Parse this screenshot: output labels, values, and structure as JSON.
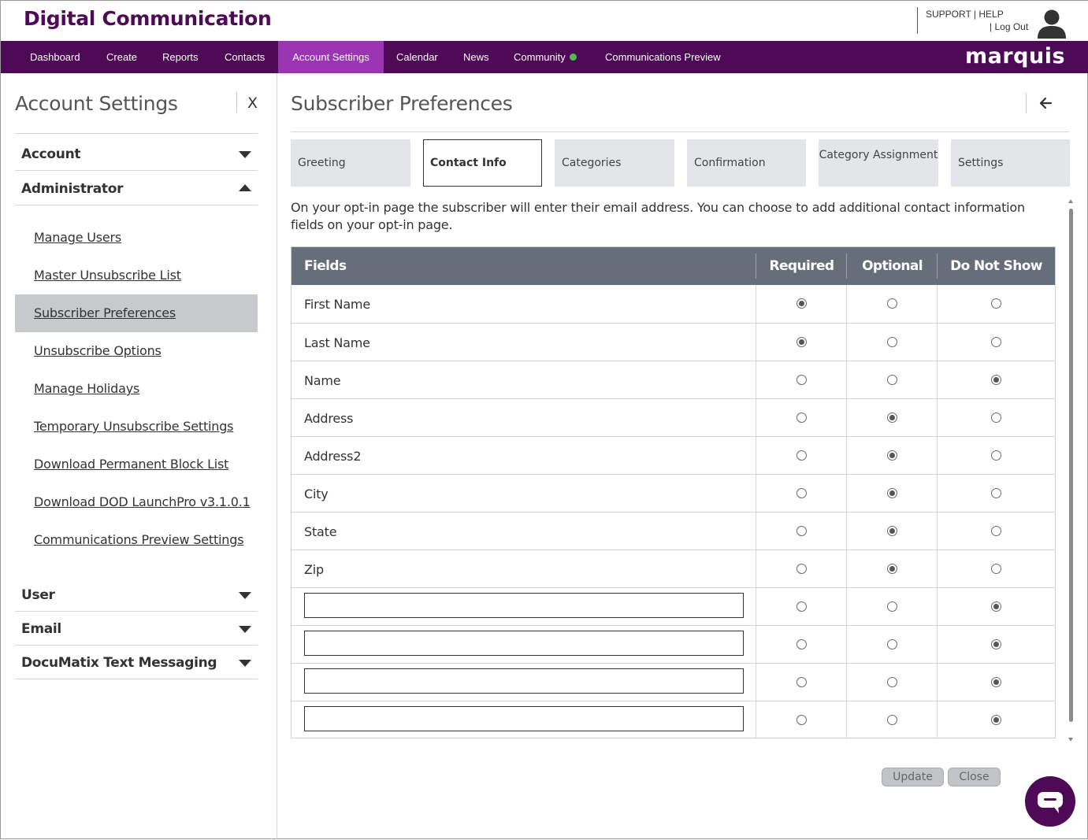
{
  "header": {
    "brand": "Digital Communication",
    "support": "SUPPORT",
    "sep1": "|",
    "help": "HELP",
    "sep2": "|",
    "logout": "Log Out",
    "logo": "marquis"
  },
  "nav": {
    "items": [
      "Dashboard",
      "Create",
      "Reports",
      "Contacts",
      "Account Settings",
      "Calendar",
      "News",
      "Community",
      "Communications Preview"
    ],
    "active": "Account Settings",
    "community_status_color": "#4cc04c"
  },
  "sidebar": {
    "title": "Account Settings",
    "close": "X",
    "sections": {
      "account": "Account",
      "administrator": "Administrator",
      "user": "User",
      "email": "Email",
      "documatix": "DocuMatix Text Messaging"
    },
    "admin_items": [
      "Manage Users",
      "Master Unsubscribe List",
      "Subscriber Preferences",
      "Unsubscribe Options",
      "Manage Holidays",
      "Temporary Unsubscribe Settings",
      "Download Permanent Block List",
      "Download DOD LaunchPro v3.1.0.1",
      "Communications Preview Settings"
    ],
    "active_item": "Subscriber Preferences"
  },
  "main": {
    "title": "Subscriber Preferences",
    "tabs": [
      "Greeting",
      "Contact Info",
      "Categories",
      "Confirmation",
      "Category Assignment",
      "Settings"
    ],
    "active_tab": "Contact Info",
    "description": "On your opt-in page the subscriber will enter their email address. You can choose to add additional contact information fields on your opt-in page.",
    "table": {
      "headers": [
        "Fields",
        "Required",
        "Optional",
        "Do Not Show"
      ],
      "rows": [
        {
          "field": "First Name",
          "choice": "Required"
        },
        {
          "field": "Last Name",
          "choice": "Required"
        },
        {
          "field": "Name",
          "choice": "Do Not Show"
        },
        {
          "field": "Address",
          "choice": "Optional"
        },
        {
          "field": "Address2",
          "choice": "Optional"
        },
        {
          "field": "City",
          "choice": "Optional"
        },
        {
          "field": "State",
          "choice": "Optional"
        },
        {
          "field": "Zip",
          "choice": "Optional"
        },
        {
          "field": "",
          "custom": true,
          "choice": "Do Not Show"
        },
        {
          "field": "",
          "custom": true,
          "choice": "Do Not Show"
        },
        {
          "field": "",
          "custom": true,
          "choice": "Do Not Show"
        },
        {
          "field": "",
          "custom": true,
          "choice": "Do Not Show"
        }
      ]
    },
    "buttons": {
      "update": "Update",
      "close": "Close"
    }
  },
  "colors": {
    "brand_purple": "#4e0a57",
    "active_nav": "#9b35b4",
    "table_header": "#666e79"
  }
}
